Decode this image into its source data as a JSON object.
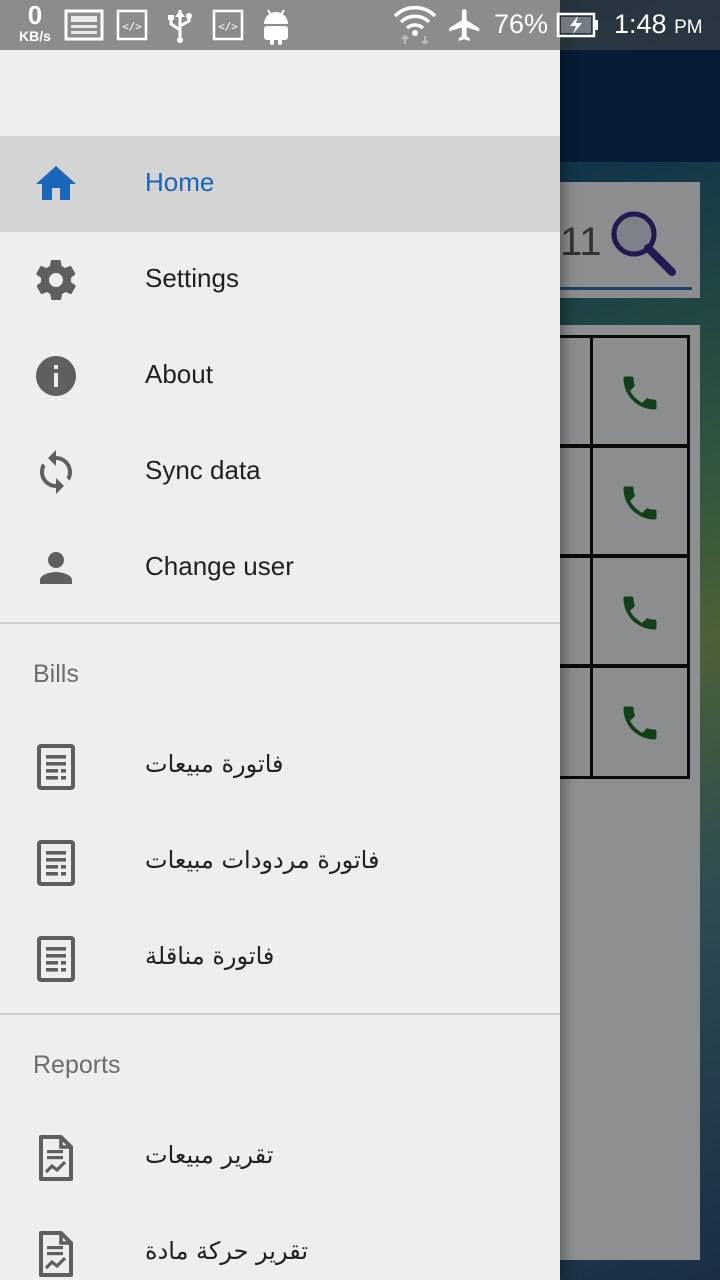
{
  "status_bar": {
    "net_speed_value": "0",
    "net_speed_unit": "KB/s",
    "battery_percent": "76%",
    "time": "1:48",
    "time_suffix": "PM"
  },
  "background": {
    "search_value": "11"
  },
  "drawer": {
    "main_items": [
      {
        "label": "Home",
        "icon": "home-icon",
        "active": true
      },
      {
        "label": "Settings",
        "icon": "gear-icon"
      },
      {
        "label": "About",
        "icon": "info-icon"
      },
      {
        "label": "Sync data",
        "icon": "sync-icon"
      },
      {
        "label": "Change user",
        "icon": "person-icon"
      }
    ],
    "bills": {
      "title": "Bills",
      "items": [
        {
          "label": "فاتورة مبيعات",
          "icon": "document-icon"
        },
        {
          "label": "فاتورة مردودات مبيعات",
          "icon": "document-icon"
        },
        {
          "label": "فاتورة مناقلة",
          "icon": "document-icon"
        }
      ]
    },
    "reports": {
      "title": "Reports",
      "items": [
        {
          "label": "تقرير مبيعات",
          "icon": "report-icon"
        },
        {
          "label": "تقرير حركة مادة",
          "icon": "report-icon"
        }
      ]
    }
  },
  "colors": {
    "accent": "#1a66b8",
    "drawer_bg": "#eeeeee",
    "icon_gray": "#5f5f5f",
    "phone_green": "#1e6b2c"
  }
}
